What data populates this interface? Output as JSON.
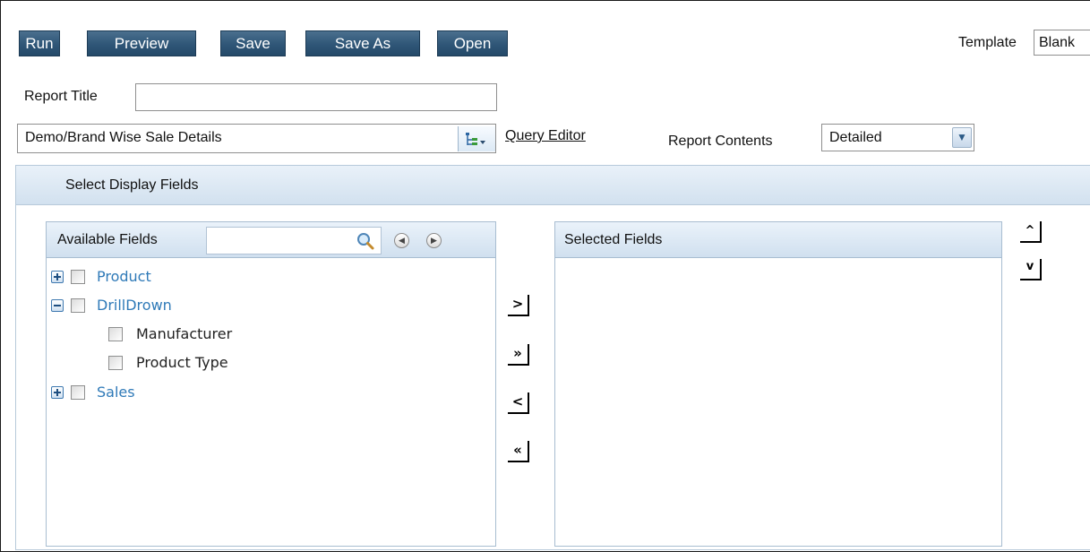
{
  "toolbar": {
    "run": "Run",
    "preview": "Preview",
    "save": "Save",
    "save_as": "Save As",
    "open": "Open"
  },
  "template": {
    "label": "Template",
    "value": "Blank"
  },
  "report_title": {
    "label": "Report Title",
    "value": ""
  },
  "query": {
    "value": "Demo/Brand Wise Sale Details",
    "editor_link": "Query Editor"
  },
  "report_contents": {
    "label": "Report Contents",
    "value": "Detailed"
  },
  "display_fields": {
    "title": "Select Display Fields",
    "available_header": "Available Fields",
    "selected_header": "Selected Fields",
    "search_value": "",
    "tree": [
      {
        "label": "Product",
        "type": "branch",
        "state": "collapsed"
      },
      {
        "label": "DrillDrown",
        "type": "branch",
        "state": "expanded"
      },
      {
        "label": "Manufacturer",
        "type": "leaf"
      },
      {
        "label": "Product Type",
        "type": "leaf"
      },
      {
        "label": "Sales",
        "type": "branch",
        "state": "collapsed"
      }
    ],
    "move_buttons": [
      ">",
      "»",
      "<",
      "«"
    ],
    "order_buttons": [
      "^",
      "v"
    ]
  },
  "colors": {
    "button_bg": "#2f5677",
    "header_bg": "#d2e1ef",
    "branch_text": "#2f7ab8"
  },
  "icons": [
    "search-icon",
    "prev-icon",
    "next-icon",
    "tree-view-icon",
    "chevron-down-icon",
    "expand-icon",
    "collapse-icon"
  ]
}
